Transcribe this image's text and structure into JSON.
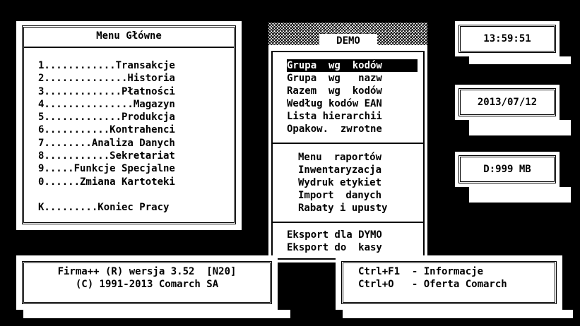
{
  "main_menu": {
    "title": "Menu Główne",
    "items": [
      "1............Transakcje",
      "2..............Historia",
      "3.............Płatności",
      "4...............Magazyn",
      "5.............Produkcja",
      "6...........Kontrahenci",
      "7........Analiza Danych",
      "8...........Sekretariat",
      "9.....Funkcje Specjalne",
      "0......Zmiana Kartoteki"
    ],
    "exit": "K.........Koniec Pracy"
  },
  "demo_menu": {
    "title": "DEMO",
    "group1": [
      "Grupa  wg  kodów",
      "Grupa  wg   nazw",
      "Razem  wg  kodów",
      "Według kodów EAN",
      "Lista hierarchii",
      "Opakow.  zwrotne"
    ],
    "selected_index": 0,
    "group2": [
      "Menu  raportów",
      "Inwentaryzacja",
      "Wydruk etykiet",
      "Import  danych",
      "Rabaty i upusty"
    ],
    "group3": [
      "Eksport dla DYMO",
      "Eksport do  kasy"
    ]
  },
  "status": {
    "time": "13:59:51",
    "date": "2013/07/12",
    "disk": "D:999 MB"
  },
  "footer": {
    "version_line": "Firma++ (R) wersja 3.52  [N20]",
    "copyright_line": "(C) 1991-2013 Comarch SA",
    "key1": "Ctrl+F1  - Informacje",
    "key2": "Ctrl+O   - Oferta Comarch"
  },
  "colors": {
    "background": "#000000",
    "panel": "#ffffff",
    "text": "#000000"
  }
}
